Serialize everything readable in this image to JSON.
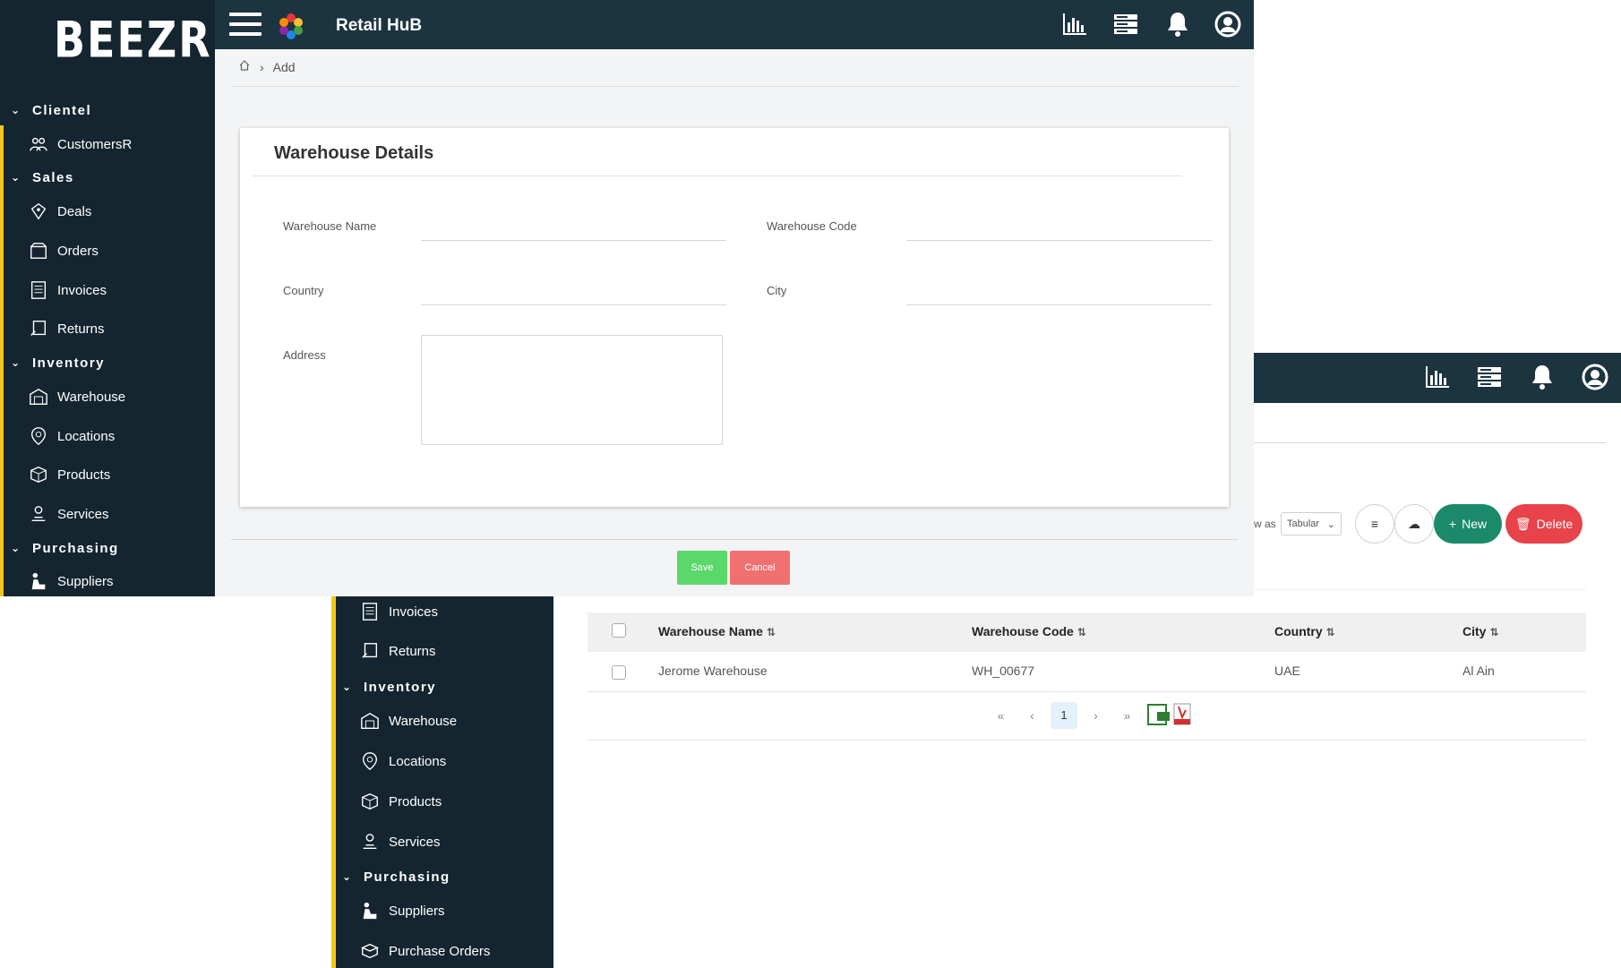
{
  "colors": {
    "topbar": "#1c3340",
    "sidebar": "#14252f",
    "sidebar_accent": "#f5c518",
    "save": "#5bd86a",
    "cancel": "#f07070",
    "new": "#1a8a6a",
    "delete": "#e8424a"
  },
  "brand": {
    "logo_text": "BEEZR",
    "app_title": "Retail HuB"
  },
  "top_icons": [
    "bar-chart-icon",
    "server-icon",
    "bell-icon",
    "user-circle-icon"
  ],
  "sidebar": {
    "sections": [
      {
        "label": "Clientel",
        "items": [
          {
            "label": "CustomersR",
            "icon": "customers-icon"
          }
        ]
      },
      {
        "label": "Sales",
        "items": [
          {
            "label": "Deals",
            "icon": "deals-icon"
          },
          {
            "label": "Orders",
            "icon": "orders-icon"
          },
          {
            "label": "Invoices",
            "icon": "invoices-icon"
          },
          {
            "label": "Returns",
            "icon": "returns-icon"
          }
        ]
      },
      {
        "label": "Inventory",
        "items": [
          {
            "label": "Warehouse",
            "icon": "warehouse-icon"
          },
          {
            "label": "Locations",
            "icon": "locations-icon"
          },
          {
            "label": "Products",
            "icon": "products-icon"
          },
          {
            "label": "Services",
            "icon": "services-icon"
          }
        ]
      },
      {
        "label": "Purchasing",
        "items": [
          {
            "label": "Suppliers",
            "icon": "suppliers-icon"
          },
          {
            "label": "Purchase Orders",
            "icon": "purchase-orders-icon"
          }
        ]
      }
    ]
  },
  "breadcrumb": {
    "current": "Add"
  },
  "form": {
    "title": "Warehouse Details",
    "fields": {
      "warehouse_name": {
        "label": "Warehouse Name",
        "value": ""
      },
      "warehouse_code": {
        "label": "Warehouse Code",
        "value": ""
      },
      "country": {
        "label": "Country",
        "value": ""
      },
      "city": {
        "label": "City",
        "value": ""
      },
      "address": {
        "label": "Address",
        "value": ""
      }
    },
    "save_label": "Save",
    "cancel_label": "Cancel"
  },
  "list": {
    "view_as_label": "w as",
    "view_select": "Tabular",
    "new_label": "New",
    "delete_label": "Delete",
    "columns": [
      "Warehouse Name",
      "Warehouse Code",
      "Country",
      "City"
    ],
    "rows": [
      {
        "name": "Jerome Warehouse",
        "code": "WH_00677",
        "country": "UAE",
        "city": "Al Ain"
      }
    ],
    "pagination": {
      "current_page": "1"
    }
  }
}
